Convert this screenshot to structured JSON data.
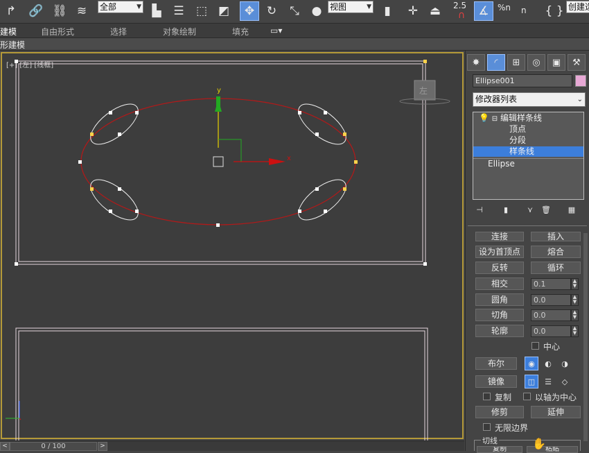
{
  "toolbar": {
    "selection_filter": "全部",
    "reference_coord": "视图",
    "angle_snap_value": "2.5",
    "percent_snap": "%n",
    "spinner_snap": "n",
    "create_selection_set": "创建选"
  },
  "ribbon": {
    "tabs": [
      {
        "label": "建模"
      },
      {
        "label": "自由形式"
      },
      {
        "label": "选择"
      },
      {
        "label": "对象绘制"
      },
      {
        "label": "填充"
      }
    ],
    "sub_label": "形建模"
  },
  "viewport": {
    "label": "[+] [左] [线框]",
    "axis_x": "x",
    "axis_y": "y"
  },
  "timeline": {
    "frame_text": "0 / 100",
    "prev": "<",
    "next": ">"
  },
  "command_panel": {
    "object_name": "Ellipse001",
    "modifier_list": "修改器列表",
    "stack": {
      "edit_spline": "编辑样条线",
      "vertex": "顶点",
      "segment": "分段",
      "spline": "样条线",
      "ellipse": "Ellipse"
    },
    "buttons": {
      "connect": "连接",
      "insert": "插入",
      "make_first": "设为首顶点",
      "fuse": "熔合",
      "reverse": "反转",
      "cycle": "循环",
      "crossinsert": "相交",
      "fillet": "圆角",
      "chamfer": "切角",
      "outline": "轮廓",
      "boolean": "布尔",
      "mirror": "镜像",
      "trim": "修剪",
      "extend": "延伸"
    },
    "spinners": {
      "crossinsert": "0.1",
      "fillet": "0.0",
      "chamfer": "0.0",
      "outline": "0.0"
    },
    "checkboxes": {
      "center": "中心",
      "copy": "复制",
      "about_pivot": "以轴为中心",
      "infinite_bounds": "无限边界"
    },
    "group_tangent": "切线",
    "group_buttons": {
      "copy": "复制",
      "paste": "粘贴"
    }
  },
  "colors": {
    "accent": "#3c7edb",
    "viewport_border": "#b59a38",
    "ellipse": "#b01a1a",
    "swatch": "#e8a9d6"
  }
}
